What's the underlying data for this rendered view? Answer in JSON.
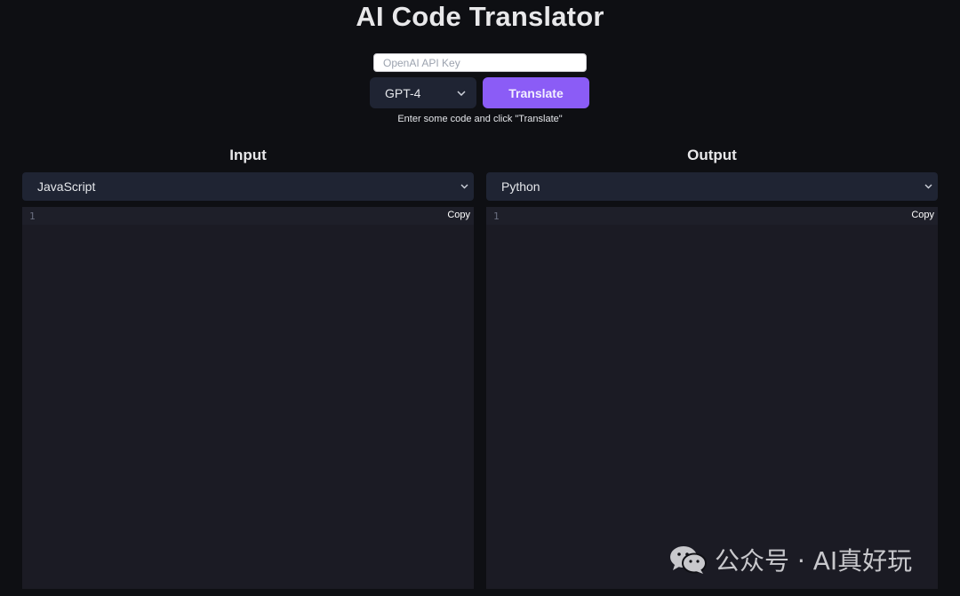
{
  "app": {
    "title": "AI Code Translator"
  },
  "controls": {
    "api_key_placeholder": "OpenAI API Key",
    "api_key_value": "",
    "model_selected": "GPT-4",
    "translate_label": "Translate",
    "hint": "Enter some code and click \"Translate\""
  },
  "input_panel": {
    "heading": "Input",
    "language": "JavaScript",
    "line_number": "1",
    "copy_label": "Copy"
  },
  "output_panel": {
    "heading": "Output",
    "language": "Python",
    "line_number": "1",
    "copy_label": "Copy"
  },
  "watermark": {
    "text": "公众号 · AI真好玩"
  },
  "colors": {
    "background": "#0e0f13",
    "accent": "#8b5cf6",
    "select_bg": "#1f2433",
    "editor_bg": "#1b1b24"
  },
  "icons": [
    "chevron-down-icon",
    "wechat-icon"
  ]
}
